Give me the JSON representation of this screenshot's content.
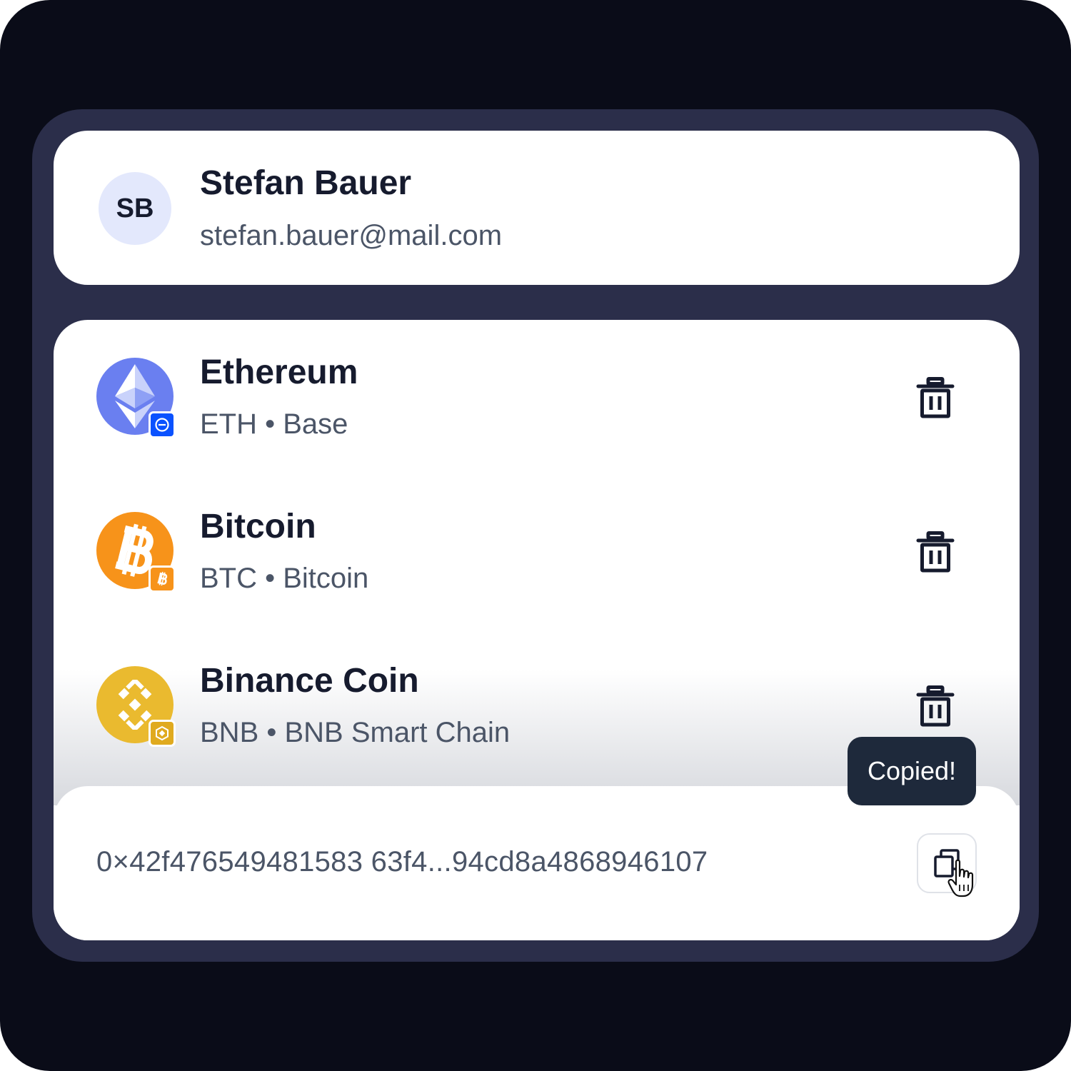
{
  "profile": {
    "initials": "SB",
    "name": "Stefan Bauer",
    "email": "stefan.bauer@mail.com"
  },
  "assets": [
    {
      "name": "Ethereum",
      "subtitle": "ETH • Base",
      "icon": "ethereum-icon",
      "chain_icon": "base-chain-icon",
      "color": "#6a7ff0",
      "badge_color": "#0a52ff"
    },
    {
      "name": "Bitcoin",
      "subtitle": "BTC • Bitcoin",
      "icon": "bitcoin-icon",
      "chain_icon": "bitcoin-chain-icon",
      "color": "#f7931a",
      "badge_color": "#f7931a"
    },
    {
      "name": "Binance Coin",
      "subtitle": "BNB • BNB Smart Chain",
      "icon": "binance-coin-icon",
      "chain_icon": "bnb-chain-icon",
      "color": "#eaba2f",
      "badge_color": "#e0aa1f"
    }
  ],
  "wallet": {
    "address": "0×42f476549481583 63f4...94cd8a4868946107"
  },
  "tooltip": {
    "text": "Copied!"
  }
}
